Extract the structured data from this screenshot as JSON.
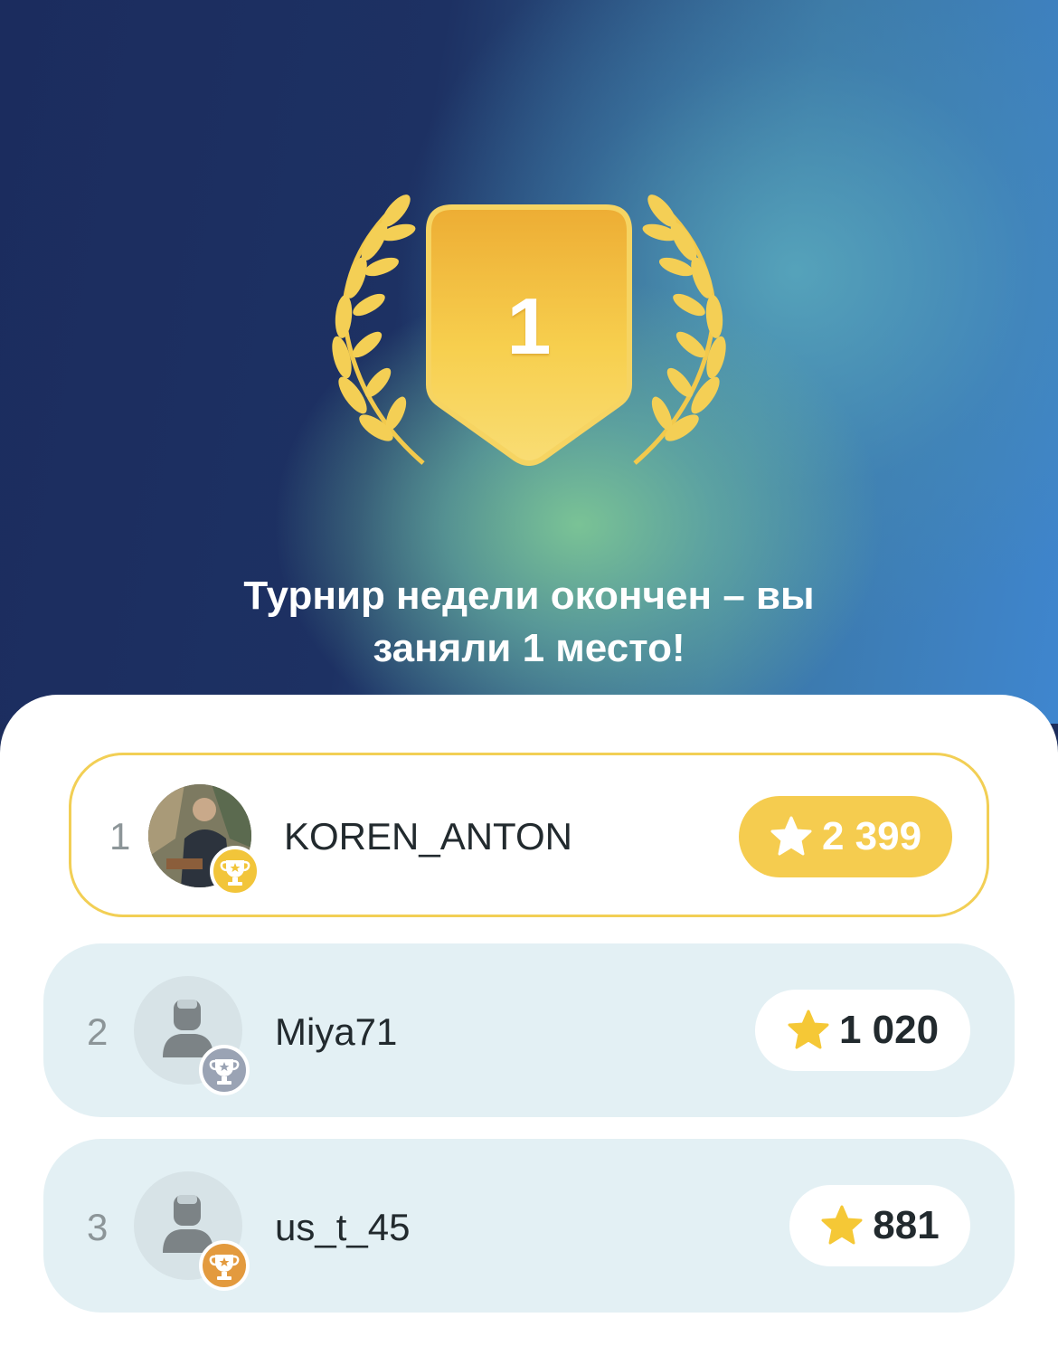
{
  "header": {
    "badge_place": "1",
    "headline_line1": "Турнир недели окончен – вы",
    "headline_line2": "заняли 1 место!"
  },
  "leaderboard": [
    {
      "rank": "1",
      "username": "KOREN_ANTON",
      "score": "2 399",
      "trophy": "gold-trophy-icon",
      "avatar": "user-photo"
    },
    {
      "rank": "2",
      "username": "Miya71",
      "score": "1 020",
      "trophy": "silver-trophy-icon",
      "avatar": "default-avatar-icon"
    },
    {
      "rank": "3",
      "username": "us_t_45",
      "score": "881",
      "trophy": "bronze-trophy-icon",
      "avatar": "default-avatar-icon"
    }
  ],
  "colors": {
    "gold": "#f5cc4f",
    "row_bg": "#e3f0f4",
    "silver": "#9aa3b4",
    "bronze": "#e39a3e",
    "hero_dark": "#1c2d5c"
  }
}
